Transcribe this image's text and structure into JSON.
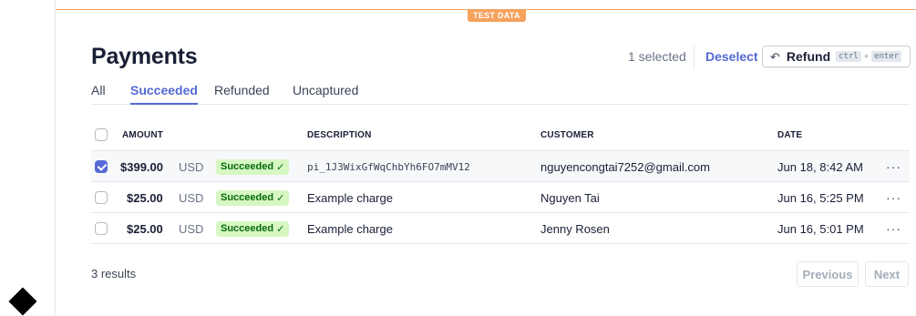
{
  "test_badge": "TEST DATA",
  "page_title": "Payments",
  "toolbar": {
    "selected_count": "1 selected",
    "deselect_label": "Deselect",
    "refund_icon": "undo-arrow-icon",
    "refund_label": "Refund",
    "shortcut_key1": "ctrl",
    "shortcut_plus": "+",
    "shortcut_key2": "enter"
  },
  "tabs": [
    {
      "label": "All",
      "active": false
    },
    {
      "label": "Succeeded",
      "active": true
    },
    {
      "label": "Refunded",
      "active": false
    },
    {
      "label": "Uncaptured",
      "active": false
    }
  ],
  "table": {
    "headers": {
      "amount": "AMOUNT",
      "description": "DESCRIPTION",
      "customer": "CUSTOMER",
      "date": "DATE"
    },
    "rows": [
      {
        "selected": true,
        "amount": "$399.00",
        "currency": "USD",
        "status": "Succeeded",
        "status_icon": "✓",
        "description": "pi_1J3WixGfWqChbYh6FO7mMV12",
        "customer": "nguyencongtai7252@gmail.com",
        "date": "Jun 18, 8:42 AM",
        "menu": "···"
      },
      {
        "selected": false,
        "amount": "$25.00",
        "currency": "USD",
        "status": "Succeeded",
        "status_icon": "✓",
        "description": "Example charge",
        "customer": "Nguyen Tai",
        "date": "Jun 16, 5:25 PM",
        "menu": "···"
      },
      {
        "selected": false,
        "amount": "$25.00",
        "currency": "USD",
        "status": "Succeeded",
        "status_icon": "✓",
        "description": "Example charge",
        "customer": "Jenny Rosen",
        "date": "Jun 16, 5:01 PM",
        "menu": "···"
      }
    ]
  },
  "footer": {
    "results": "3 results",
    "previous_label": "Previous",
    "next_label": "Next"
  },
  "colors": {
    "accent": "#5469d4",
    "test_mode": "#f5a25d",
    "success_bg": "#d7f7c2",
    "success_text": "#05690d"
  }
}
